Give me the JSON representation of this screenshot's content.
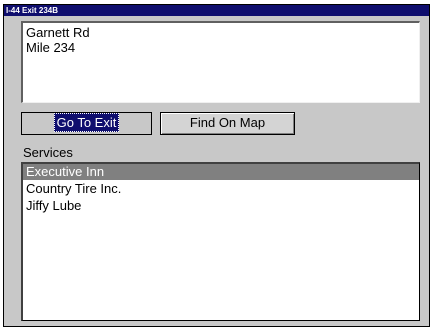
{
  "window": {
    "title": "I-44 Exit 234B"
  },
  "info": {
    "line1": "Garnett Rd",
    "line2": "Mile 234"
  },
  "buttons": {
    "go_to_exit": "Go To Exit",
    "find_on_map": "Find On Map"
  },
  "services": {
    "label": "Services",
    "items": [
      {
        "label": "Executive Inn",
        "selected": true
      },
      {
        "label": "Country Tire Inc.",
        "selected": false
      },
      {
        "label": "Jiffy Lube",
        "selected": false
      }
    ]
  },
  "colors": {
    "titlebar": "#0f0e6e",
    "selection": "#808080",
    "panel": "#c8c8c8"
  }
}
